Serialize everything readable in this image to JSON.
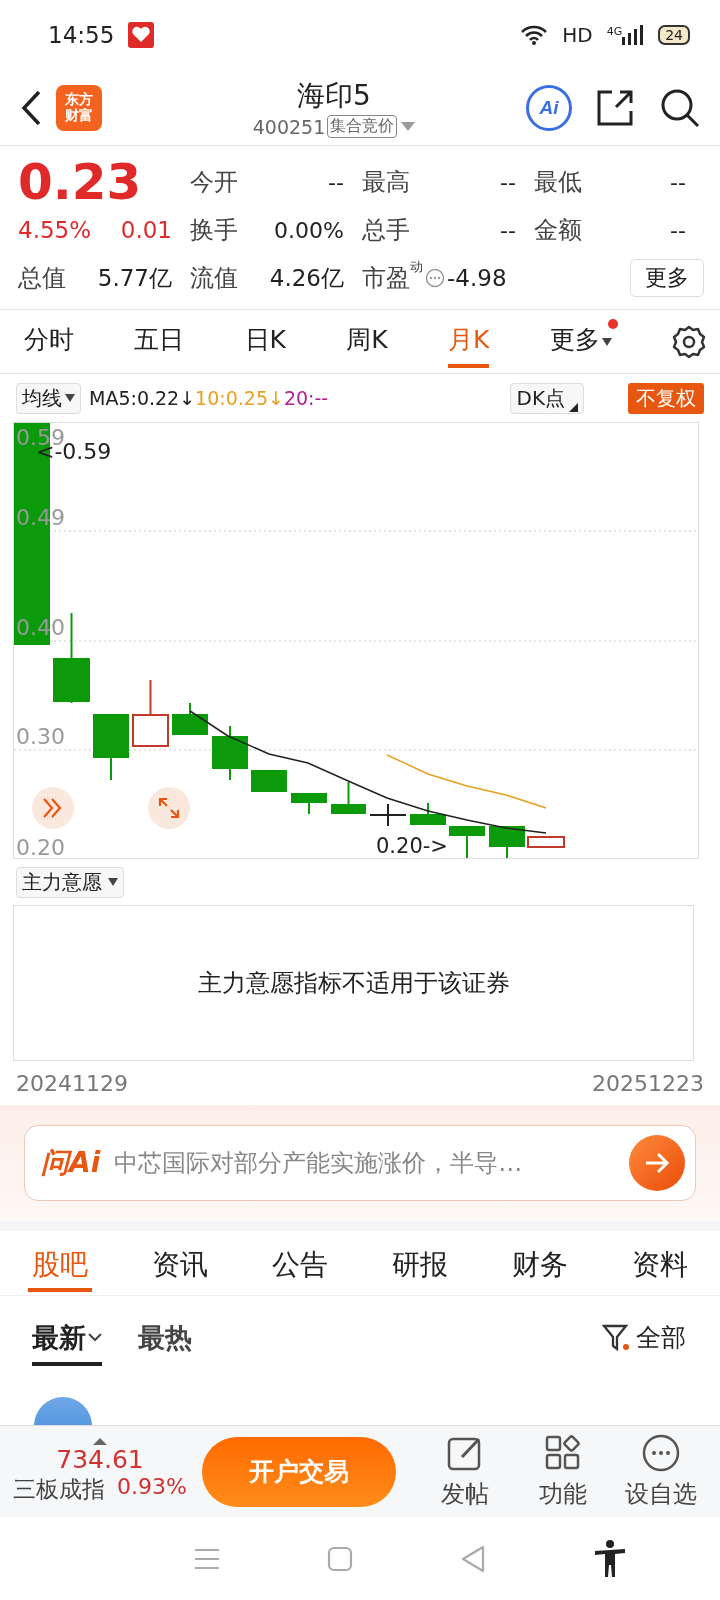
{
  "status_bar": {
    "time": "14:55",
    "network": "HD",
    "cell": "4G",
    "battery": "24"
  },
  "header": {
    "logo": [
      "东方",
      "财富"
    ],
    "title": "海印5",
    "code": "400251",
    "tag": "集合竞价",
    "ai_button": "Ai"
  },
  "quote": {
    "price": "0.23",
    "change_pct": "4.55%",
    "change": "0.01",
    "market_value": {
      "label": "总值",
      "value": "5.77亿"
    },
    "stats": [
      [
        {
          "label": "今开",
          "value": "--"
        },
        {
          "label": "最高",
          "value": "--"
        },
        {
          "label": "最低",
          "value": "--"
        }
      ],
      [
        {
          "label": "换手",
          "value": "0.00%"
        },
        {
          "label": "总手",
          "value": "--"
        },
        {
          "label": "金额",
          "value": "--"
        }
      ],
      [
        {
          "label": "流值",
          "value": "4.26亿"
        },
        {
          "label": "市盈",
          "sup": "动",
          "value": "-4.98"
        }
      ]
    ],
    "more_button": "更多"
  },
  "period_tabs": [
    {
      "label": "分时",
      "selected": false
    },
    {
      "label": "五日",
      "selected": false
    },
    {
      "label": "日K",
      "selected": false
    },
    {
      "label": "周K",
      "selected": false
    },
    {
      "label": "月K",
      "selected": true
    }
  ],
  "more_tab": {
    "label": "更多",
    "dot": true
  },
  "indicator_bar": {
    "selector": "均线",
    "ma": [
      {
        "text": "MA5:0.22↓",
        "color": "#222222"
      },
      {
        "text": "10:0.25↓",
        "color": "#e8a020"
      },
      {
        "text": "20:--",
        "color": "#b0208a"
      }
    ],
    "dk_button": "DK点",
    "adjust_button": "不复权"
  },
  "chart": {
    "y_labels": [
      "0.59",
      "0.49",
      "0.40",
      "0.30",
      "0.20"
    ],
    "high_marker": "<-0.59",
    "low_marker": "0.20->"
  },
  "indicator": {
    "selector": "主力意愿",
    "message": "主力意愿指标不适用于该证券"
  },
  "date_range": {
    "start": "20241129",
    "end": "20251223"
  },
  "ask_ai": {
    "logo": "问Ai",
    "prompt": "中芯国际对部分产能实施涨价，半导…"
  },
  "content_tabs": [
    {
      "label": "股吧",
      "selected": true
    },
    {
      "label": "资讯",
      "selected": false
    },
    {
      "label": "公告",
      "selected": false
    },
    {
      "label": "研报",
      "selected": false
    },
    {
      "label": "财务",
      "selected": false
    },
    {
      "label": "资料",
      "selected": false
    }
  ],
  "sort_tabs": [
    {
      "label": "最新",
      "selected": true
    },
    {
      "label": "最热",
      "selected": false
    }
  ],
  "filter": "全部",
  "bottom_bar": {
    "index_value": "734.61",
    "index_name": "三板成指",
    "index_change": "0.93%",
    "trade_button": "开户交易",
    "actions": [
      {
        "kind": "post",
        "label": "发帖"
      },
      {
        "kind": "apps",
        "label": "功能"
      },
      {
        "kind": "more",
        "label": "设自选"
      }
    ]
  }
}
